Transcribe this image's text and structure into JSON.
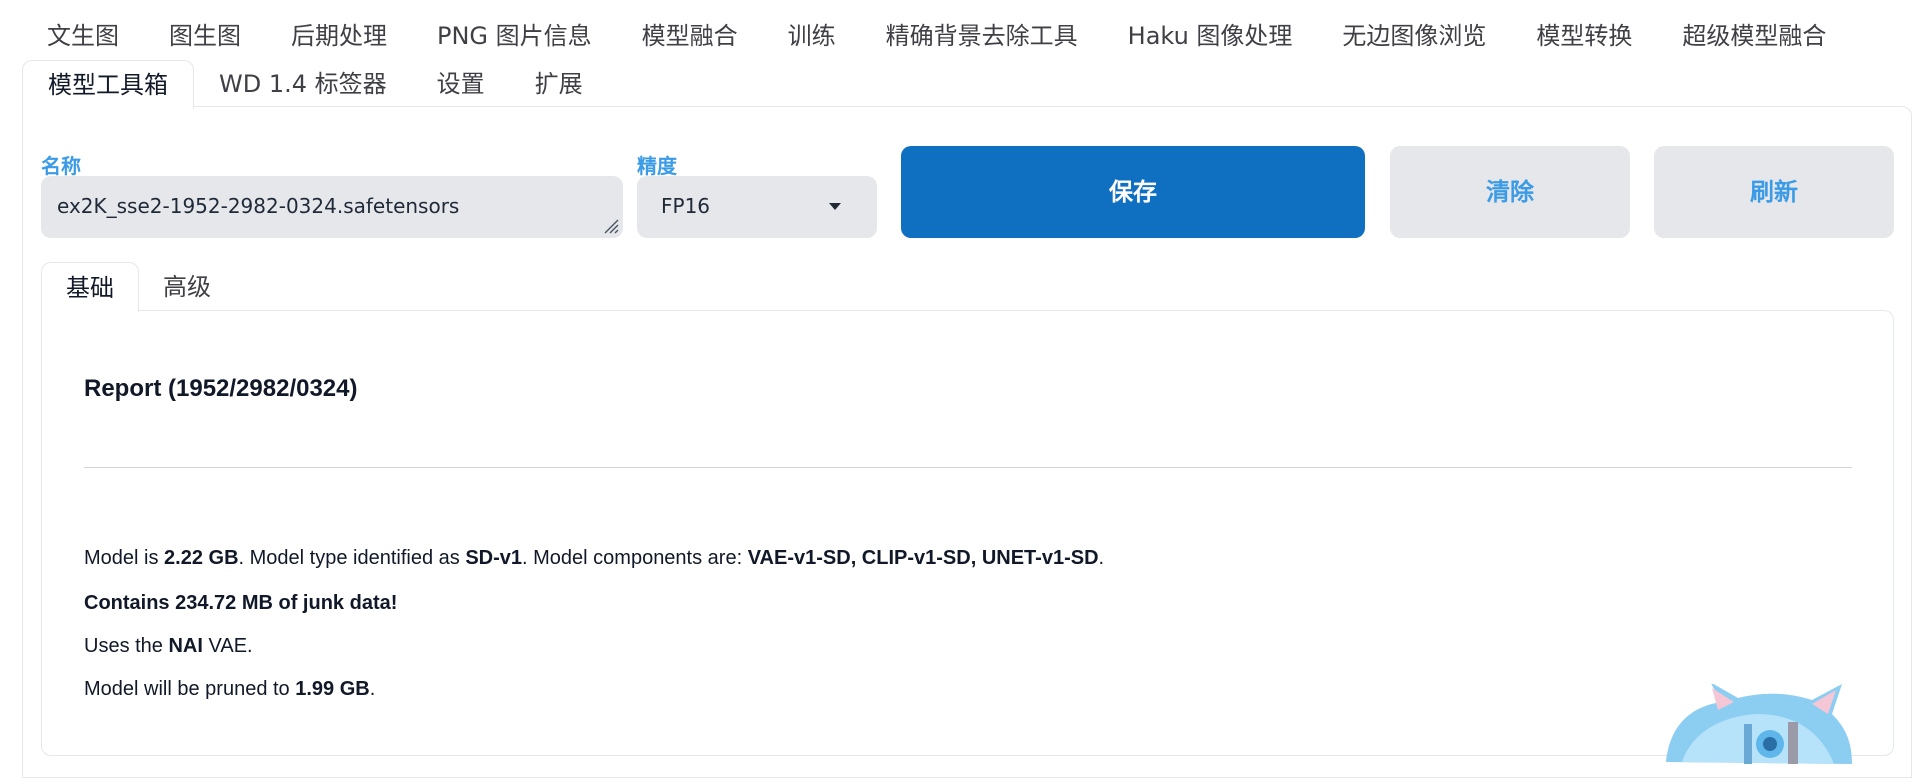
{
  "tabs_row1": [
    "文生图",
    "图生图",
    "后期处理",
    "PNG 图片信息",
    "模型融合",
    "训练",
    "精确背景去除工具",
    "Haku 图像处理",
    "无边图像浏览",
    "模型转换",
    "超级模型融合"
  ],
  "tabs_row2": [
    "模型工具箱",
    "WD 1.4 标签器",
    "设置",
    "扩展"
  ],
  "form": {
    "name_label": "名称",
    "name_value": "ex2K_sse2-1952-2982-0324.safetensors",
    "precision_label": "精度",
    "precision_value": "FP16",
    "save_label": "保存",
    "clear_label": "清除",
    "refresh_label": "刷新"
  },
  "subtabs": [
    "基础",
    "高级"
  ],
  "report": {
    "title": "Report (1952/2982/0324)",
    "line1": {
      "t1": "Model is ",
      "size": "2.22 GB",
      "t2": ". Model type identified as ",
      "type": "SD-v1",
      "t3": ". Model components are: ",
      "components": "VAE-v1-SD, CLIP-v1-SD, UNET-v1-SD",
      "t4": "."
    },
    "line2": "Contains 234.72 MB of junk data!",
    "line3": {
      "t1": "Uses the ",
      "vae": "NAI",
      "t2": " VAE."
    },
    "line4": {
      "t1": "Model will be pruned to ",
      "size": "1.99 GB",
      "t2": "."
    }
  },
  "colors": {
    "accent": "#0f6fc0",
    "label_blue": "#3b9be6",
    "field_bg": "#e5e7eb"
  }
}
